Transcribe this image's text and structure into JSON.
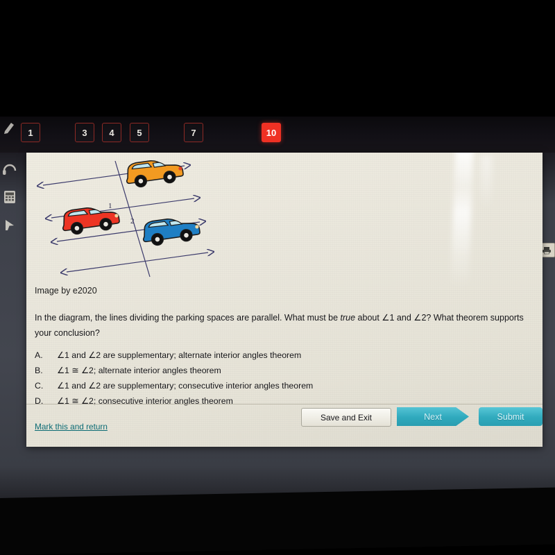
{
  "question_tabs": [
    {
      "label": "1",
      "state": "visited"
    },
    {
      "label": "3",
      "state": "visited"
    },
    {
      "label": "4",
      "state": "visited"
    },
    {
      "label": "5",
      "state": "visited"
    },
    {
      "label": "7",
      "state": "visited"
    },
    {
      "label": "10",
      "state": "current"
    }
  ],
  "toolbar": {
    "print_icon": "printer-icon",
    "tools": [
      "highlighter-icon",
      "headphone-icon",
      "calculator-icon",
      "pointer-icon"
    ]
  },
  "diagram": {
    "angle_label_1": "1",
    "angle_label_2": "2",
    "cars": [
      {
        "name": "orange-car",
        "color": "#f29a21",
        "window": "#bfe6ef"
      },
      {
        "name": "red-car",
        "color": "#ed3524",
        "window": "#bfe6ef"
      },
      {
        "name": "blue-car",
        "color": "#1f7fc4",
        "window": "#bfe6ef"
      }
    ],
    "line_color": "#3b3a6b"
  },
  "content": {
    "credit": "Image by e2020",
    "question_part1": "In the diagram, the lines dividing the parking spaces are parallel. What must be ",
    "question_italic": "true",
    "question_part2": " about ∠1 and ∠2? What theorem supports your conclusion?"
  },
  "choices": [
    {
      "letter": "A.",
      "text": "∠1 and ∠2 are supplementary; alternate interior angles theorem"
    },
    {
      "letter": "B.",
      "text": "∠1 ≅ ∠2; alternate interior angles theorem"
    },
    {
      "letter": "C.",
      "text": "∠1 and ∠2 are supplementary; consecutive interior angles theorem"
    },
    {
      "letter": "D.",
      "text": "∠1 ≅ ∠2; consecutive interior angles theorem"
    }
  ],
  "footer": {
    "mark_link": "Mark this and return",
    "save_exit": "Save and Exit",
    "next": "Next",
    "submit": "Submit"
  },
  "colors": {
    "active_tab": "#ef3124",
    "tab_outline": "#8e2a25",
    "teal_button": "#2fa9bd",
    "link": "#0b6b74",
    "panel_bg": "#eae7dc"
  }
}
